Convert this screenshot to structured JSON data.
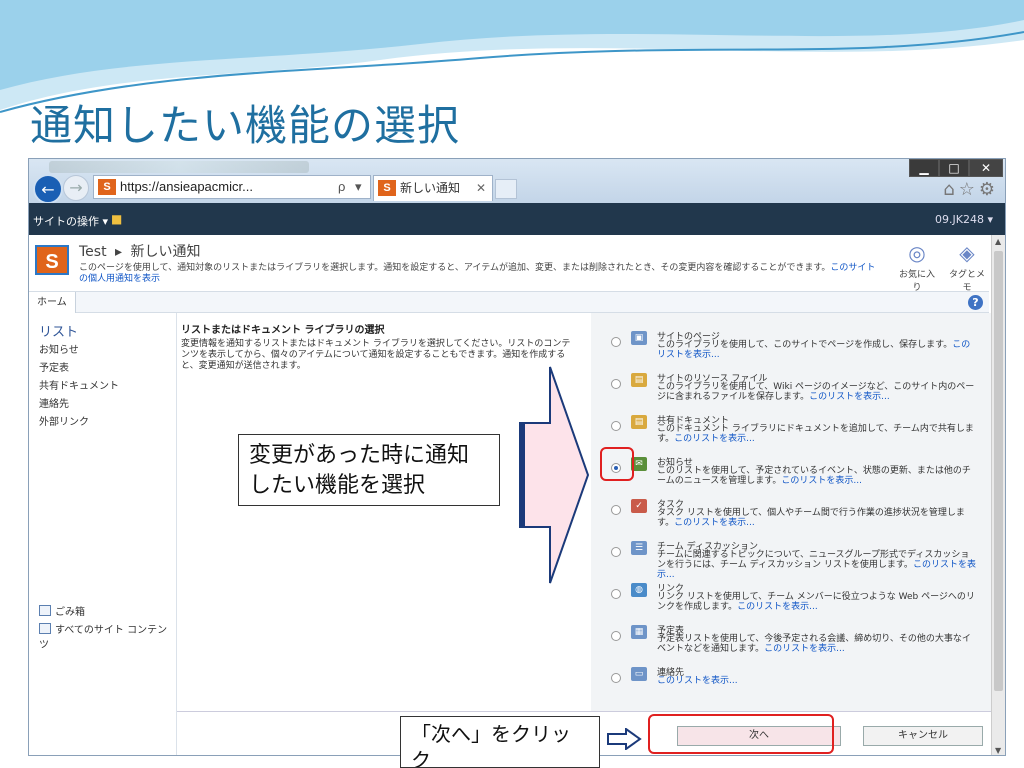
{
  "slide": {
    "title": "通知したい機能の選択",
    "callout_select": "変更があった時に通知したい機能を選択",
    "callout_next": "「次へ」をクリック"
  },
  "browser": {
    "address": "https://ansieapacmicr...",
    "address_tools": "ρ ▾ 🔒 ↻ ✕",
    "tab_title": "新しい通知",
    "tab_close": "✕",
    "window_controls": {
      "minimize": "▁",
      "maximize": "□",
      "close": "✕"
    },
    "ie_icons": "⌂☆⚙",
    "back_icon": "←",
    "forward_icon": "→"
  },
  "ribbon": {
    "site_actions": "サイトの操作 ▾",
    "user": "09.JK248 ▾"
  },
  "header": {
    "logo_letter": "S",
    "breadcrumb_site": "Test",
    "breadcrumb_sep": "▸",
    "breadcrumb_page": "新しい通知",
    "description": "このページを使用して、通知対象のリストまたはライブラリを選択します。通知を設定すると、アイテムが追加、変更、または削除されたとき、その変更内容を確認することができます。",
    "description_link": "このサイトの個人用通知を表示",
    "like_label": "お気に入り",
    "tags_label": "タグとメモ"
  },
  "tabbar": {
    "home_tab": "ホーム",
    "help": "?"
  },
  "leftnav": {
    "heading": "リスト",
    "items": [
      "お知らせ",
      "予定表",
      "共有ドキュメント",
      "連絡先",
      "外部リンク"
    ],
    "recycle": "ごみ箱",
    "all_content": "すべてのサイト コンテンツ"
  },
  "section": {
    "title": "リストまたはドキュメント ライブラリの選択",
    "description": "変更情報を通知するリストまたはドキュメント ライブラリを選択してください。リストのコンテンツを表示してから、個々のアイテムについて通知を設定することもできます。通知を作成すると、変更通知が送信されます。"
  },
  "options": [
    {
      "name": "サイトのページ",
      "desc": "このライブラリを使用して、このサイトでページを作成し、保存します。",
      "link": "このリストを表示..."
    },
    {
      "name": "サイトのリソース ファイル",
      "desc": "このライブラリを使用して、Wiki ページのイメージなど、このサイト内のページに含まれるファイルを保存します。",
      "link": "このリストを表示..."
    },
    {
      "name": "共有ドキュメント",
      "desc": "このドキュメント ライブラリにドキュメントを追加して、チーム内で共有します。",
      "link": "このリストを表示..."
    },
    {
      "name": "お知らせ",
      "desc": "このリストを使用して、予定されているイベント、状態の更新、または他のチームのニュースを管理します。",
      "link": "このリストを表示..."
    },
    {
      "name": "タスク",
      "desc": "タスク リストを使用して、個人やチーム間で行う作業の進捗状況を管理します。",
      "link": "このリストを表示..."
    },
    {
      "name": "チーム ディスカッション",
      "desc": "チームに関連するトピックについて、ニュースグループ形式でディスカッションを行うには、チーム ディスカッション リストを使用します。",
      "link": "このリストを表示..."
    },
    {
      "name": "リンク",
      "desc": "リンク リストを使用して、チーム メンバーに役立つような Web ページへのリンクを作成します。",
      "link": "このリストを表示..."
    },
    {
      "name": "予定表",
      "desc": "予定表リストを使用して、今後予定される会議、締め切り、その他の大事なイベントなどを通知します。",
      "link": "このリストを表示..."
    },
    {
      "name": "連絡先",
      "desc": "",
      "link": "このリストを表示..."
    }
  ],
  "selected_option_index": 3,
  "buttons": {
    "next": "次へ",
    "cancel": "キャンセル"
  },
  "colors": {
    "accent": "#1f6fa0",
    "ribbon": "#21374c",
    "highlight": "#e02020",
    "link": "#0f55c6"
  }
}
